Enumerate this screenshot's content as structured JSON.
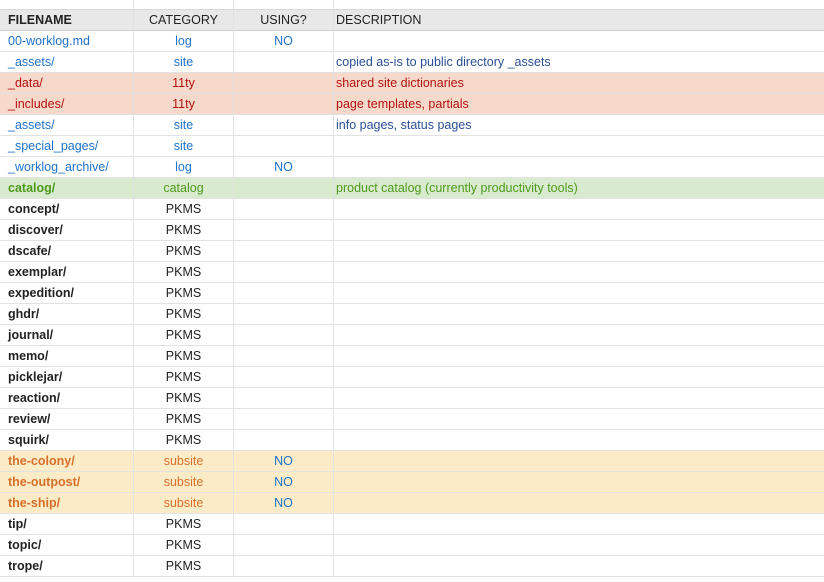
{
  "header": {
    "filename": "FILENAME",
    "category": "CATEGORY",
    "using": "USING?",
    "description": "DESCRIPTION"
  },
  "colors": {
    "blue_text": "#1f72c9",
    "dark_blue_text": "#2a4f96",
    "red_text": "#b2120f",
    "red_bg": "#f7d9cc",
    "green_text": "#4e9a1c",
    "green_bg": "#d8ebcf",
    "orange_text": "#d9702a",
    "orange_bg": "#fcebc7",
    "black_text": "#222222"
  },
  "rows": [
    {
      "filename": "00-worklog.md",
      "category": "log",
      "using": "NO",
      "description": "",
      "style": "blue"
    },
    {
      "filename": "_assets/",
      "category": "site",
      "using": "",
      "description": "copied as-is to public directory _assets",
      "style": "blue"
    },
    {
      "filename": "_data/",
      "category": "11ty",
      "using": "",
      "description": "shared site dictionaries",
      "style": "red"
    },
    {
      "filename": "_includes/",
      "category": "11ty",
      "using": "",
      "description": "page templates, partials",
      "style": "red"
    },
    {
      "filename": "_assets/",
      "category": "site",
      "using": "",
      "description": "info pages, status pages",
      "style": "blue"
    },
    {
      "filename": "_special_pages/",
      "category": "site",
      "using": "",
      "description": "",
      "style": "blue"
    },
    {
      "filename": "_worklog_archive/",
      "category": "log",
      "using": "NO",
      "description": "",
      "style": "blue"
    },
    {
      "filename": "catalog/",
      "category": "catalog",
      "using": "",
      "description": "product catalog (currently productivity tools)",
      "style": "green"
    },
    {
      "filename": "concept/",
      "category": "PKMS",
      "using": "",
      "description": "",
      "style": "black"
    },
    {
      "filename": "discover/",
      "category": "PKMS",
      "using": "",
      "description": "",
      "style": "black"
    },
    {
      "filename": "dscafe/",
      "category": "PKMS",
      "using": "",
      "description": "",
      "style": "black"
    },
    {
      "filename": "exemplar/",
      "category": "PKMS",
      "using": "",
      "description": "",
      "style": "black"
    },
    {
      "filename": "expedition/",
      "category": "PKMS",
      "using": "",
      "description": "",
      "style": "black"
    },
    {
      "filename": "ghdr/",
      "category": "PKMS",
      "using": "",
      "description": "",
      "style": "black"
    },
    {
      "filename": "journal/",
      "category": "PKMS",
      "using": "",
      "description": "",
      "style": "black"
    },
    {
      "filename": "memo/",
      "category": "PKMS",
      "using": "",
      "description": "",
      "style": "black"
    },
    {
      "filename": "picklejar/",
      "category": "PKMS",
      "using": "",
      "description": "",
      "style": "black"
    },
    {
      "filename": "reaction/",
      "category": "PKMS",
      "using": "",
      "description": "",
      "style": "black"
    },
    {
      "filename": "review/",
      "category": "PKMS",
      "using": "",
      "description": "",
      "style": "black"
    },
    {
      "filename": "squirk/",
      "category": "PKMS",
      "using": "",
      "description": "",
      "style": "black"
    },
    {
      "filename": "the-colony/",
      "category": "subsite",
      "using": "NO",
      "description": "",
      "style": "orange"
    },
    {
      "filename": "the-outpost/",
      "category": "subsite",
      "using": "NO",
      "description": "",
      "style": "orange"
    },
    {
      "filename": "the-ship/",
      "category": "subsite",
      "using": "NO",
      "description": "",
      "style": "orange"
    },
    {
      "filename": "tip/",
      "category": "PKMS",
      "using": "",
      "description": "",
      "style": "black"
    },
    {
      "filename": "topic/",
      "category": "PKMS",
      "using": "",
      "description": "",
      "style": "black"
    },
    {
      "filename": "trope/",
      "category": "PKMS",
      "using": "",
      "description": "",
      "style": "black"
    }
  ]
}
